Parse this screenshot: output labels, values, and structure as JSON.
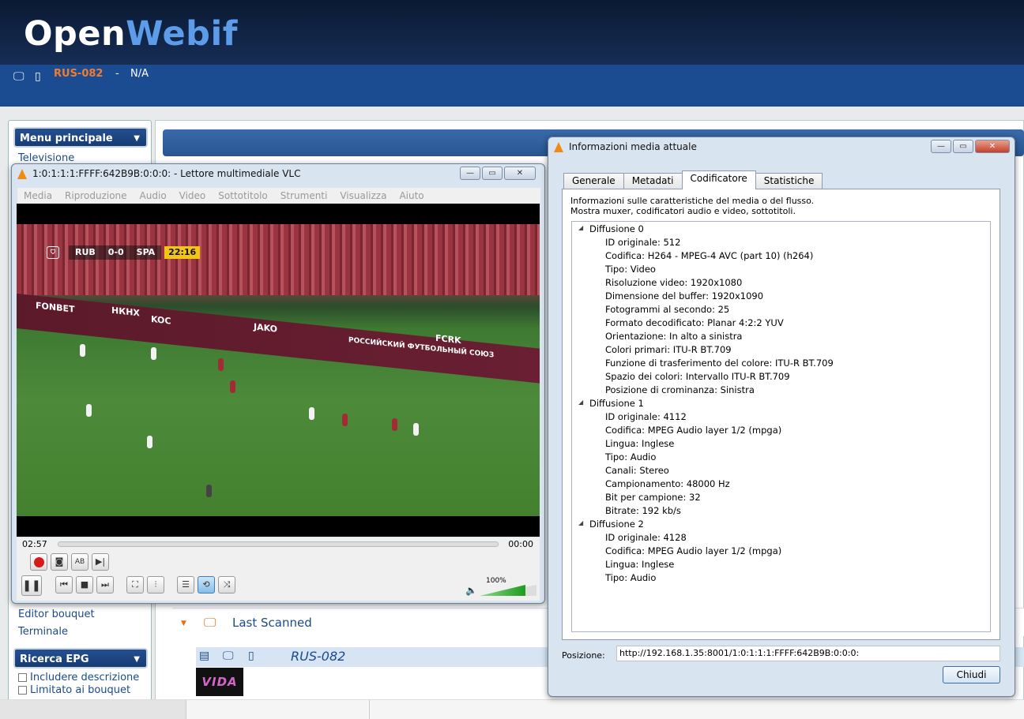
{
  "header": {
    "logo_a": "Open",
    "logo_b": "Webif"
  },
  "status": {
    "box_name": "RUS-082",
    "separator": "-",
    "state": "N/A"
  },
  "sidebar": {
    "main_menu": "Menu principale",
    "items_top": [
      "Televisione"
    ],
    "items_bottom": [
      "Editor bouquet",
      "Terminale"
    ],
    "epg_title": "Ricerca EPG",
    "epg_options": [
      "Includere descrizione",
      "Limitato ai bouquet"
    ]
  },
  "main": {
    "bouquet_label": "Last Scanned",
    "channel_name": "RUS-082",
    "channel_logo": "VIDA"
  },
  "vlc": {
    "title": "1:0:1:1:1:FFFF:642B9B:0:0:0: - Lettore multimediale VLC",
    "menu": [
      "Media",
      "Riproduzione",
      "Audio",
      "Video",
      "Sottotitolo",
      "Strumenti",
      "Visualizza",
      "Aiuto"
    ],
    "time_elapsed": "02:57",
    "time_total": "00:00",
    "volume_label": "100%",
    "volume_level": 1.0,
    "scoreboard": {
      "home": "RUB",
      "score": "0-0",
      "away": "SPA",
      "clock": "22:16"
    },
    "ads": [
      "FONBET",
      "НКНХ",
      "KOC",
      "JAKO",
      "РОССИЙСКИЙ ФУТБОЛЬНЫЙ СОЮЗ",
      "FCRK"
    ]
  },
  "info": {
    "title": "Informazioni media attuale",
    "tabs": [
      "Generale",
      "Metadati",
      "Codificatore",
      "Statistiche"
    ],
    "active_tab": "Codificatore",
    "desc_line1": "Informazioni sulle caratteristiche del media o del flusso.",
    "desc_line2": "Mostra muxer, codificatori audio e video, sottotitoli.",
    "streams": [
      {
        "head": "Diffusione 0",
        "items": [
          "ID originale: 512",
          "Codifica: H264 - MPEG-4 AVC (part 10) (h264)",
          "Tipo: Video",
          "Risoluzione video: 1920x1080",
          "Dimensione del buffer: 1920x1090",
          "Fotogrammi al secondo: 25",
          "Formato decodificato: Planar 4:2:2 YUV",
          "Orientazione: In alto a sinistra",
          "Colori primari: ITU-R BT.709",
          "Funzione di trasferimento del colore: ITU-R BT.709",
          "Spazio dei colori: Intervallo ITU-R BT.709",
          "Posizione di crominanza: Sinistra"
        ]
      },
      {
        "head": "Diffusione 1",
        "items": [
          "ID originale: 4112",
          "Codifica: MPEG Audio layer 1/2 (mpga)",
          "Lingua: Inglese",
          "Tipo: Audio",
          "Canali: Stereo",
          "Campionamento: 48000 Hz",
          "Bit per campione: 32",
          "Bitrate: 192 kb/s"
        ]
      },
      {
        "head": "Diffusione 2",
        "items": [
          "ID originale: 4128",
          "Codifica: MPEG Audio layer 1/2 (mpga)",
          "Lingua: Inglese",
          "Tipo: Audio"
        ]
      }
    ],
    "position_label": "Posizione:",
    "position_value": "http://192.168.1.35:8001/1:0:1:1:1:FFFF:642B9B:0:0:0:",
    "close_label": "Chiudi"
  },
  "colors": {
    "accent_orange": "#f07c30",
    "header_blue": "#1b4b91",
    "logo_blue": "#5c9ce8"
  }
}
